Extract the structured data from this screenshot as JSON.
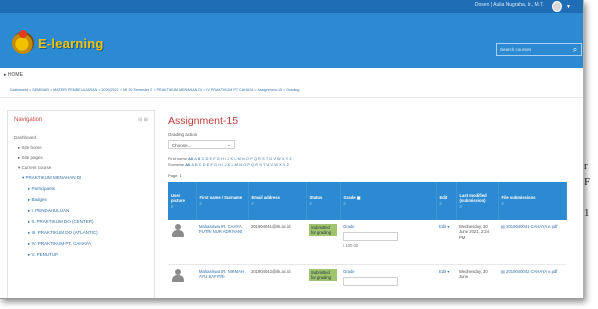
{
  "topbar": {
    "user": "Dosen | Aulia Nugraha, Ir., M.T."
  },
  "header": {
    "logo_text": "E-learning",
    "search_placeholder": "Search courses"
  },
  "home_label": "▸ HOME",
  "breadcrumb": "Dashboard  >  SEMINAR  >  MATERI PEMBELAJARAN  >  2020/2021  >  MI 20 Semester 2  >  PRAKTIKUM MENAHAN DI  >  IV PRAKTIKUM PT CAHAYA  >  Assignment-15  >  Grading",
  "sidebar": {
    "title": "Navigation",
    "control": "⊟ ⊞",
    "items": [
      "Dashboard",
      "▸ Site home",
      "▸ Site pages",
      "▾ Current course",
      "▾ PRAKTIKUM MENAHAN DI",
      "▸ Participants",
      "▸ Badges",
      "▸ I. PENDAHULUAN",
      "▸ II. PRAKTIKUM DO (CENTER)",
      "▸ III. PRAKTIKUM DO (ATLANTIC)",
      "▸ IV. PRAKTIKUM PT. CAHAYA",
      "▸ V. PENUTUP"
    ]
  },
  "main": {
    "title": "Assignment-15",
    "grading_action_label": "Grading action",
    "grading_action_value": "Choose...",
    "first_name_label": "First name",
    "surname_label": "Surname",
    "all_label": "All",
    "letters": "A B C D E F G H I J K L M N O P Q R S T U V W X Y Z",
    "page_label": "Page: 1",
    "columns": [
      "User picture",
      "First name / Surname",
      "Email address",
      "Status",
      "Grade",
      "Edit",
      "Last modified (submission)",
      "File submissions"
    ],
    "sort_icon": "≡",
    "rows": [
      {
        "name": "Mahasiswa IR. CAHYA PUTRI NUR ADRIYANI",
        "email": "201904041@itk.ac.id",
        "status": "Submitted for grading",
        "grade_label": "Grade",
        "grade_outof": "/ 100.00",
        "edit": "Edit ▾",
        "modified": "Wednesday, 30 June 2021, 2:24 PM",
        "file": "2019040041 CAHAYA e.pdf"
      },
      {
        "name": "Mahasiswa IR. NIKMAH AYU SAFITRI",
        "email": "201904042@itk.ac.id",
        "status": "Submitted for grading",
        "grade_label": "Grade",
        "grade_outof": "",
        "edit": "Edit ▾",
        "modified": "Wednesday, 30 June",
        "file": "2019040042 CAHAYA e.pdf"
      }
    ]
  },
  "outside": {
    "line1": "r",
    "line2": "F",
    "line3": "1"
  }
}
